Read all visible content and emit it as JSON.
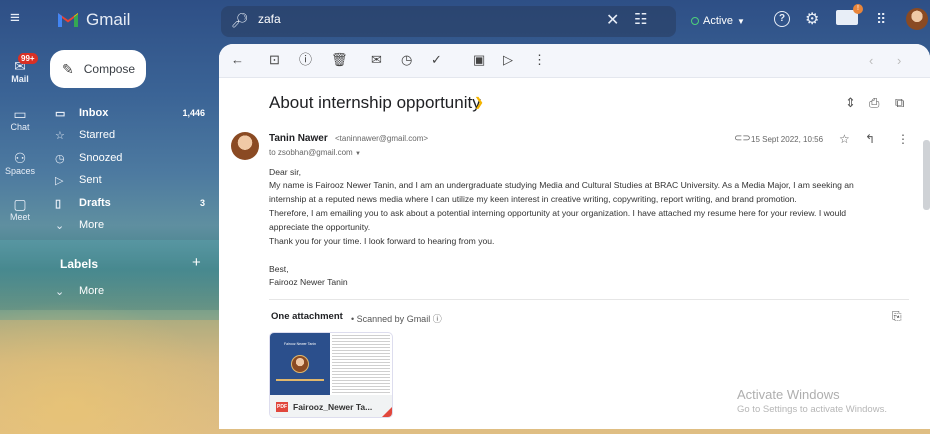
{
  "app": {
    "brand": "Gmail"
  },
  "search": {
    "value": "zafa"
  },
  "status": {
    "label": "Active"
  },
  "notifications": {
    "badge": "!"
  },
  "rail": {
    "mail_badge": "99+",
    "items": [
      {
        "label": "Mail",
        "icon": "mail-icon"
      },
      {
        "label": "Chat",
        "icon": "chat-icon"
      },
      {
        "label": "Spaces",
        "icon": "spaces-icon"
      },
      {
        "label": "Meet",
        "icon": "meet-icon"
      }
    ]
  },
  "nav": {
    "compose_label": "Compose",
    "items": [
      {
        "label": "Inbox",
        "count": "1,446",
        "icon": "inbox-icon"
      },
      {
        "label": "Starred",
        "count": "",
        "icon": "star-icon"
      },
      {
        "label": "Snoozed",
        "count": "",
        "icon": "clock-icon"
      },
      {
        "label": "Sent",
        "count": "",
        "icon": "send-icon"
      },
      {
        "label": "Drafts",
        "count": "3",
        "icon": "draft-icon"
      },
      {
        "label": "More",
        "count": "",
        "icon": "chevron-down-icon"
      }
    ],
    "labels_heading": "Labels",
    "labels_more": "More"
  },
  "email": {
    "subject": "About internship opportunity",
    "sender_name": "Tanin Nawer",
    "sender_email": "<taninnawer@gmail.com>",
    "to": "to zsobhan@gmail.com",
    "date": "15 Sept 2022, 10:56",
    "body": [
      "Dear sir,",
      "My name is Fairooz Newer Tanin, and I am an undergraduate studying Media and Cultural Studies at BRAC University. As a Media Major, I am seeking an",
      "internship at a reputed news media where I can utilize my keen interest in creative writing, copywriting, report writing, and brand promotion.",
      "Therefore, I am emailing you to ask about a potential interning opportunity at your organization. I have attached my resume here for your review. I would",
      "appreciate the opportunity.",
      "Thank you for your time. I look forward to hearing from you.",
      "",
      "Best,",
      "Fairooz Newer Tanin"
    ],
    "attachment_title": "One attachment",
    "attachment_scan": "• Scanned by Gmail ⓘ",
    "attachment_filename": "Fairooz_Newer Ta...",
    "attachment_type": "PDF",
    "resume_thumb_text": "Fairooz Newer Tanin"
  },
  "watermark": {
    "line1": "Activate Windows",
    "line2": "Go to Settings to activate Windows."
  },
  "colors": {
    "gmail_red": "#ea4335",
    "active_green": "#4ed17a",
    "important_yellow": "#f4b400"
  }
}
